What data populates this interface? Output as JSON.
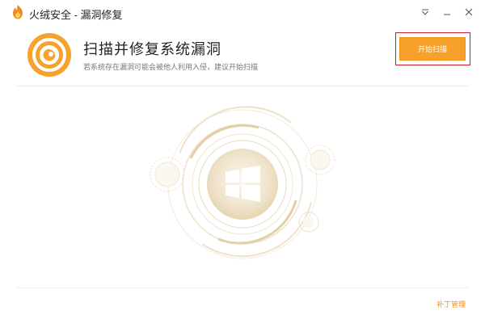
{
  "window": {
    "title": "火绒安全 - 漏洞修复",
    "controls": [
      "menu-icon",
      "minimize-icon",
      "close-icon"
    ]
  },
  "header": {
    "title": "扫描并修复系统漏洞",
    "subtitle": "若系统存在漏洞可能会被他人利用入侵，建议开始扫描",
    "start_button": "开始扫描"
  },
  "illustration": {
    "icon": "windows-logo-icon",
    "accent_color": "#e3cfa7"
  },
  "footer": {
    "patch_management": "补丁管理"
  },
  "colors": {
    "brand_orange": "#f8a12a",
    "highlight_red": "#cf1b2b",
    "link_orange": "#e9922a"
  }
}
